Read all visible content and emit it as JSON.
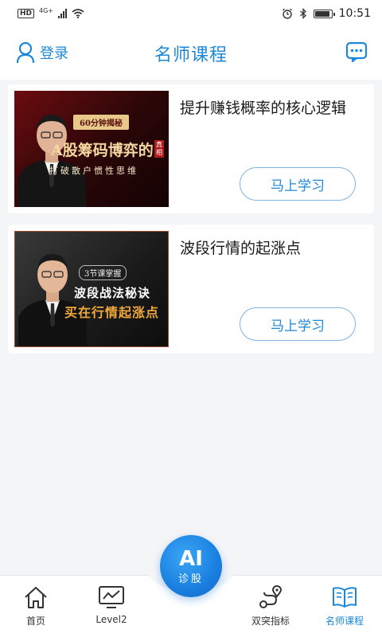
{
  "status_bar": {
    "hd": "HD",
    "network": "4G+",
    "time": "10:51"
  },
  "header": {
    "login_label": "登录",
    "title": "名师课程"
  },
  "courses": [
    {
      "title": "提升赚钱概率的核心逻辑",
      "thumb_top": "60分钟揭秘",
      "thumb_main": "A股筹码博弈的",
      "thumb_tag": "真相",
      "thumb_sub": "打破散户惯性思维",
      "button": "马上学习"
    },
    {
      "title": "波段行情的起涨点",
      "thumb_top": "3节课掌握",
      "thumb_main": "波段战法秘诀",
      "thumb_sub": "买在行情起涨点",
      "button": "马上学习"
    }
  ],
  "ai_button": {
    "main": "AI",
    "sub": "诊股"
  },
  "bottom_nav": {
    "items": [
      {
        "label": "首页",
        "icon": "home-icon"
      },
      {
        "label": "Level2",
        "icon": "monitor-chart-icon"
      },
      {
        "label": "双突指标",
        "icon": "route-icon"
      },
      {
        "label": "名师课程",
        "icon": "book-icon"
      }
    ],
    "active": "名师课程"
  },
  "colors": {
    "accent": "#1e88d8",
    "background": "#f4f5f7"
  }
}
